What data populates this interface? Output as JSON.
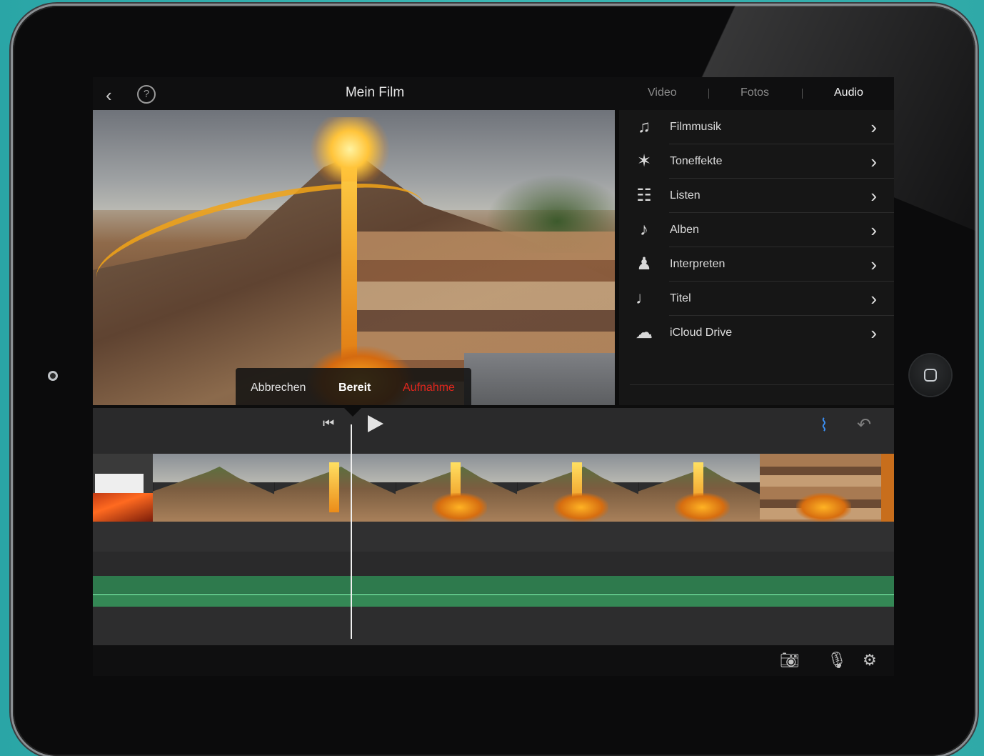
{
  "header": {
    "back_icon": "chevron-left-icon",
    "help_icon": "help-icon",
    "help_glyph": "?",
    "title": "Mein Film",
    "tabs": [
      {
        "label": "Video",
        "active": false
      },
      {
        "label": "Fotos",
        "active": false
      },
      {
        "label": "Audio",
        "active": true
      }
    ]
  },
  "recorder": {
    "cancel_label": "Abbrechen",
    "ready_label": "Bereit",
    "record_label": "Aufnahme",
    "record_color": "#e0261d",
    "level": 0.14
  },
  "library": {
    "items": [
      {
        "icon": "music-note-icon",
        "label": "Filmmusik"
      },
      {
        "icon": "sound-effects-icon",
        "label": "Toneffekte"
      },
      {
        "icon": "playlist-icon",
        "label": "Listen"
      },
      {
        "icon": "album-icon",
        "label": "Alben"
      },
      {
        "icon": "artist-icon",
        "label": "Interpreten"
      },
      {
        "icon": "song-icon",
        "label": "Titel"
      },
      {
        "icon": "cloud-icon",
        "label": "iCloud Drive"
      }
    ]
  },
  "transport": {
    "skip_icon": "skip-to-start-icon",
    "play_icon": "play-icon",
    "waveform_icon": "waveform-icon",
    "undo_icon": "undo-icon",
    "waveform_color": "#3b8ff3"
  },
  "bottombar": {
    "icons": [
      "camera-icon",
      "microphone-icon",
      "settings-icon"
    ]
  }
}
